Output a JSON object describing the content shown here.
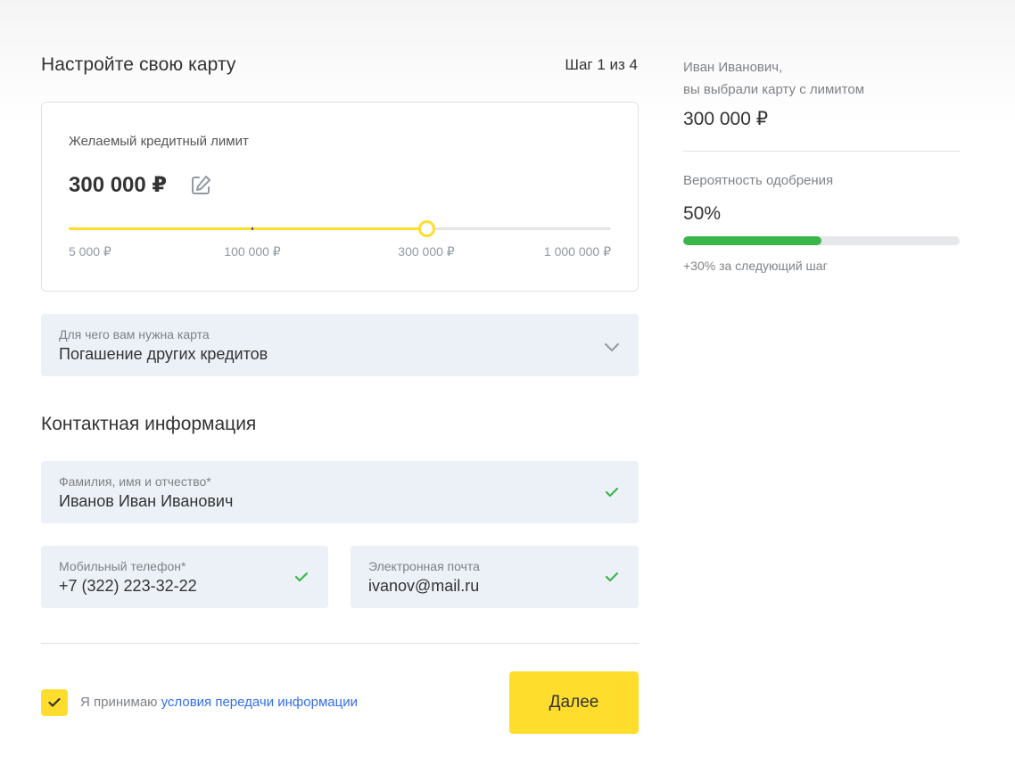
{
  "header": {
    "title": "Настройте свою карту",
    "step": "Шаг 1 из 4"
  },
  "limit_card": {
    "label": "Желаемый кредитный лимит",
    "value": "300 000 ₽",
    "edit_icon": "edit-icon",
    "slider": {
      "min": 5000,
      "max": 1000000,
      "current": 300000,
      "marks": [
        "5 000 ₽",
        "100 000 ₽",
        "300 000 ₽",
        "1 000 000 ₽"
      ],
      "track_color": "#e5e5e5",
      "fill_color": "#ffdd2d"
    }
  },
  "purpose": {
    "label": "Для чего вам нужна карта",
    "value": "Погашение других кредитов",
    "icon": "chevron-down-icon"
  },
  "contact": {
    "title": "Контактная информация",
    "full_name": {
      "label": "Фамилия, имя и отчество*",
      "value": "Иванов Иван Иванович",
      "icon": "check-icon"
    },
    "phone": {
      "label": "Мобильный телефон*",
      "value": "+7 (322) 223-32-22",
      "icon": "check-icon"
    },
    "email": {
      "label": "Электронная почта",
      "value": "ivanov@mail.ru",
      "icon": "check-icon"
    }
  },
  "consent": {
    "checked": true,
    "text": "Я принимаю",
    "link": "условия передачи информации"
  },
  "next_button": {
    "label": "Далее"
  },
  "summary": {
    "greeting_line1": "Иван Иванович,",
    "greeting_line2": "вы выбрали карту с лимитом",
    "limit": "300 000 ₽",
    "approval_label": "Вероятность одобрения",
    "approval_value": "50%",
    "approval_fraction": 0.5,
    "approval_color": "#3bb54a",
    "approval_hint": "+30% за следующий шаг"
  },
  "colors": {
    "accent": "#ffdd2d",
    "field_bg": "#ecf1f7",
    "link": "#336fee",
    "success": "#3bb54a"
  }
}
